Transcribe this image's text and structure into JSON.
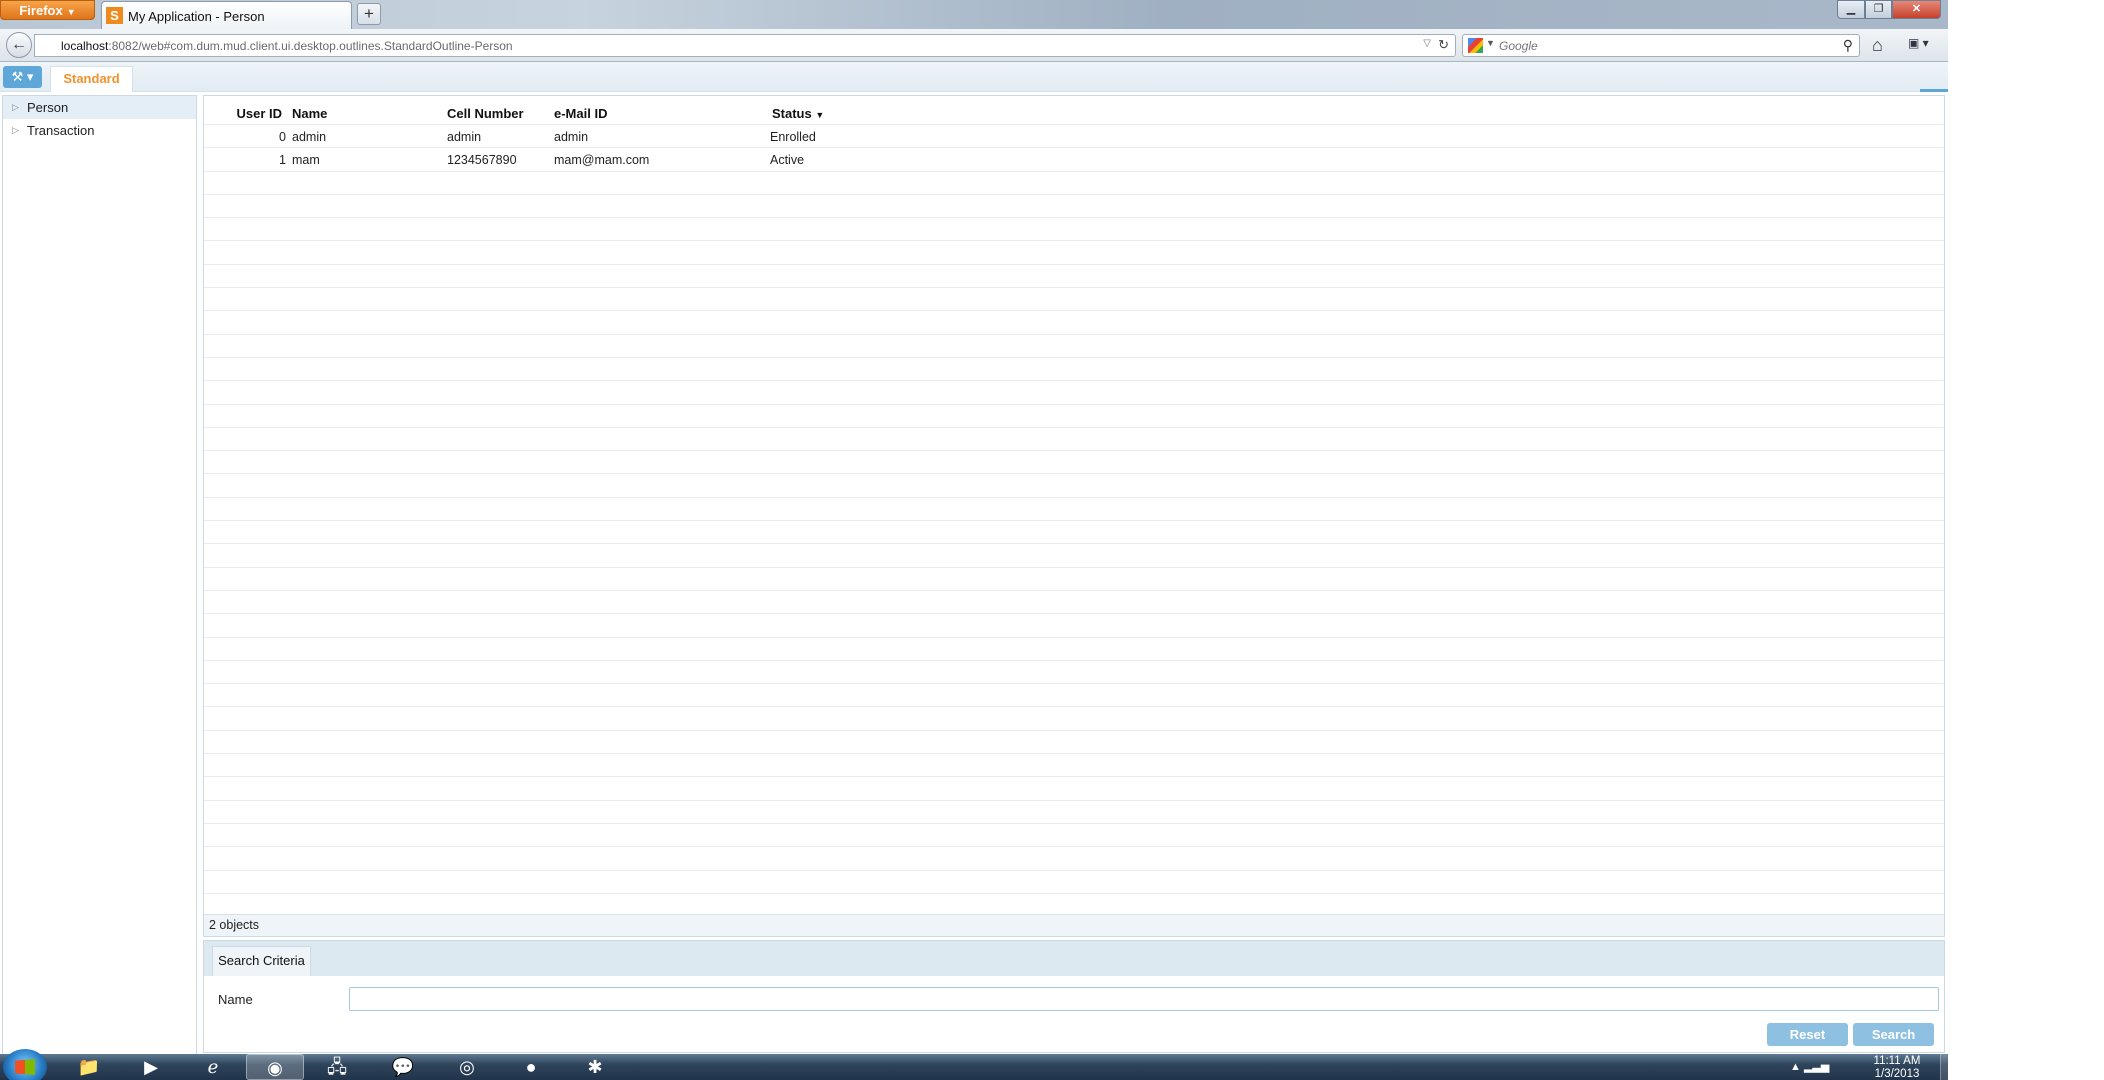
{
  "browser": {
    "menu_label": "Firefox",
    "tab_title": "My Application - Person",
    "tab_favicon_letter": "S",
    "new_tab": "+",
    "url_host": "localhost",
    "url_rest": ":8082/web#com.dum.mud.client.ui.desktop.outlines.StandardOutline-Person",
    "search_placeholder": "Google"
  },
  "app": {
    "toolbar_tab": "Standard",
    "tree": [
      "Person",
      "Transaction"
    ],
    "table": {
      "columns": [
        "User ID",
        "Name",
        "Cell Number",
        "e-Mail ID",
        "Status"
      ],
      "rows": [
        {
          "user_id": "0",
          "name": "admin",
          "cell": "admin",
          "email": "admin",
          "status": "Enrolled"
        },
        {
          "user_id": "1",
          "name": "mam",
          "cell": "1234567890",
          "email": "mam@mam.com",
          "status": "Active"
        }
      ],
      "count_text": "2 objects"
    },
    "search": {
      "tab_label": "Search Criteria",
      "name_label": "Name",
      "name_value": "",
      "reset_label": "Reset",
      "search_label": "Search"
    }
  },
  "taskbar": {
    "time": "11:11 AM",
    "date": "1/3/2013"
  },
  "colors": {
    "accent": "#5fa7d9",
    "tab_text": "#f0932b",
    "button": "#8ec0e2"
  }
}
